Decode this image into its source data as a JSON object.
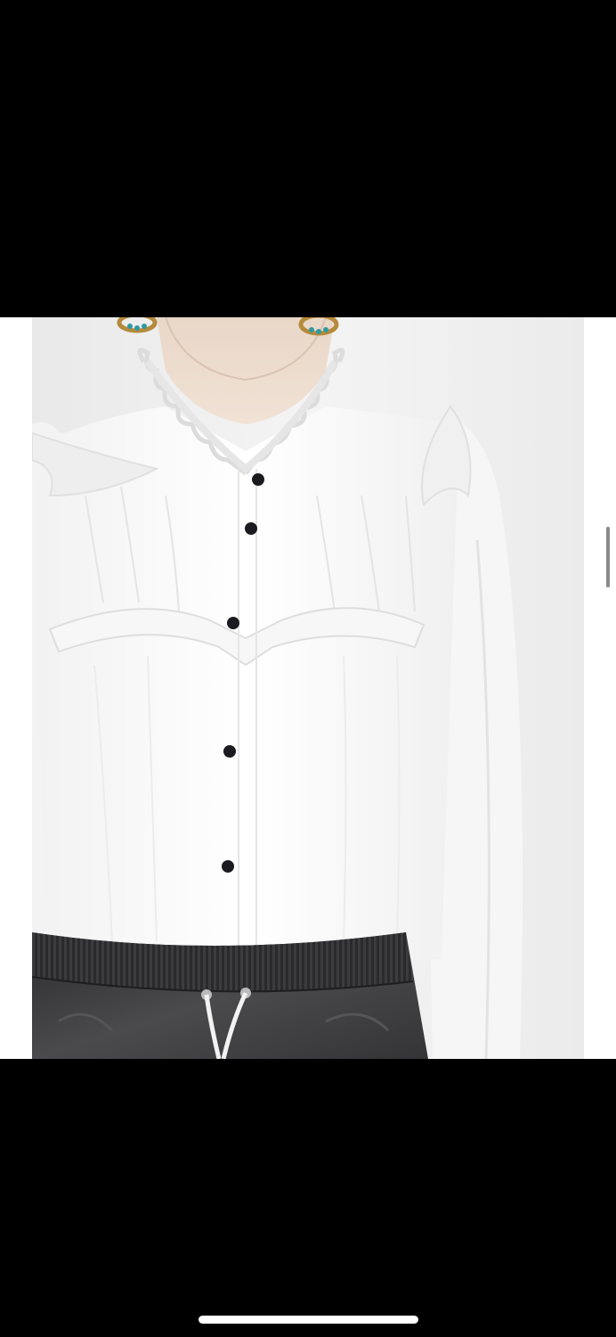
{
  "viewer": {
    "background_color": "#000000",
    "image_backdrop_color": "#ffffff",
    "photo": {
      "subject_icon": "product-photo",
      "shirt_color": "#ffffff",
      "button_color": "#1b1b1f",
      "pants_color": "#3a3a3c",
      "drawstring_color": "#f2f2f2",
      "earring_colors": [
        "#b58a3a",
        "#2e9aa0"
      ]
    }
  },
  "system": {
    "home_indicator_color": "#ffffff",
    "scroll_indicator_color": "#8a8a8a"
  }
}
